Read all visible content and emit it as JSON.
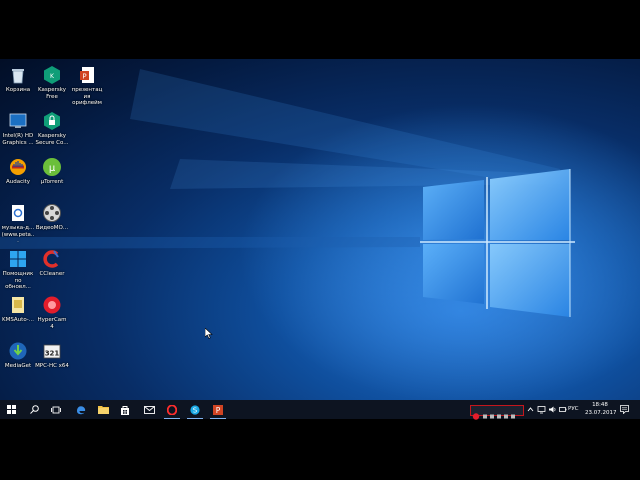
{
  "desktop": {
    "icons": [
      {
        "label": "Корзина",
        "icon": "recycle-bin-icon"
      },
      {
        "label": "Kaspersky Free",
        "icon": "kaspersky-icon"
      },
      {
        "label": "презентация орифлейм",
        "icon": "powerpoint-file-icon"
      },
      {
        "label": "Intel(R) HD Graphics ...",
        "icon": "intel-graphics-icon"
      },
      {
        "label": "Kaspersky Secure Co...",
        "icon": "kaspersky-secure-icon"
      },
      {
        "label": "Audacity",
        "icon": "audacity-icon"
      },
      {
        "label": "µTorrent",
        "icon": "utorrent-icon"
      },
      {
        "label": "музыка-д... (www.peta...",
        "icon": "music-file-icon"
      },
      {
        "label": "ВидеоМО...",
        "icon": "video-reel-icon"
      },
      {
        "label": "Помощник по обновл...",
        "icon": "windows-update-assistant-icon"
      },
      {
        "label": "CCleaner",
        "icon": "ccleaner-icon"
      },
      {
        "label": "KMSAuto-...",
        "icon": "kmsauto-file-icon"
      },
      {
        "label": "HyperCam 4",
        "icon": "hypercam-icon"
      },
      {
        "label": "MediaGet",
        "icon": "mediaget-icon"
      },
      {
        "label": "MPC-HC x64",
        "icon": "mpc-hc-icon"
      }
    ]
  },
  "taskbar": {
    "items": [
      "start-icon",
      "search-icon",
      "task-view-icon",
      "edge-icon",
      "file-explorer-icon",
      "store-icon",
      "mail-icon",
      "opera-icon",
      "skype-icon",
      "powerpoint-icon"
    ],
    "active": [
      "opera-icon",
      "skype-icon",
      "powerpoint-icon"
    ],
    "language": "РУС",
    "time": "18:48",
    "date": "23.07.2017"
  },
  "colors": {
    "taskbar": "#0d1421",
    "desktop_glow": "#2b7ad6",
    "desktop_dark": "#041a40"
  }
}
